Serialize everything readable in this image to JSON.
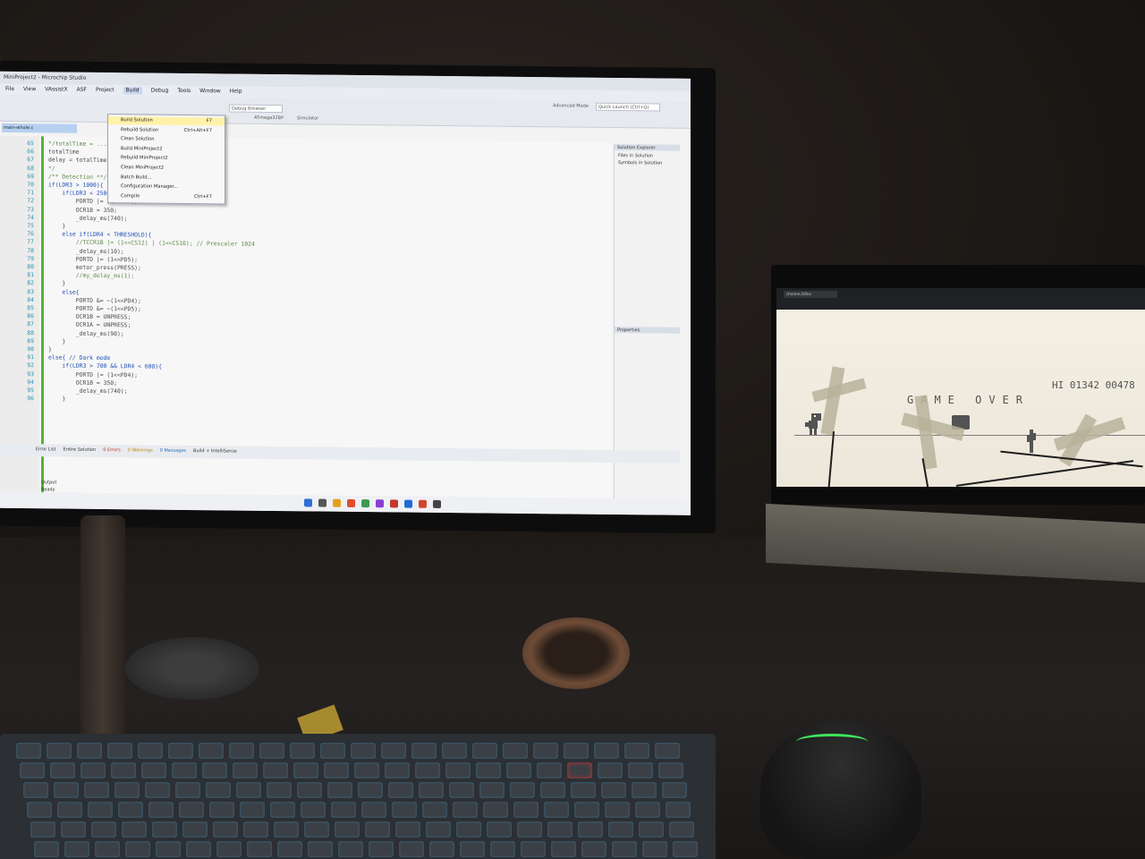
{
  "vs": {
    "title": "MiniProject2 - Microchip Studio",
    "menu": [
      "File",
      "View",
      "VAssistX",
      "ASF",
      "Project",
      "Build",
      "Debug",
      "Tools",
      "Window",
      "Help"
    ],
    "active_menu": "Build",
    "toolbar": {
      "debug_config": "Debug Browser",
      "device": "ATmega328P",
      "tool": "Simulator",
      "mode": "Advanced Mode",
      "quick_launch": "Quick Launch (Ctrl+Q)"
    },
    "tab_name": "main-whole.c",
    "build_menu": [
      {
        "label": "Build Solution",
        "shortcut": "F7"
      },
      {
        "label": "Rebuild Solution",
        "shortcut": "Ctrl+Alt+F7"
      },
      {
        "label": "Clean Solution",
        "shortcut": ""
      },
      {
        "label": "Build MiniProject2",
        "shortcut": ""
      },
      {
        "label": "Rebuild MiniProject2",
        "shortcut": ""
      },
      {
        "label": "Clean MiniProject2",
        "shortcut": ""
      },
      {
        "label": "Batch Build...",
        "shortcut": ""
      },
      {
        "label": "Configuration Manager...",
        "shortcut": ""
      },
      {
        "label": "Compile",
        "shortcut": "Ctrl+F7"
      }
    ],
    "code": [
      {
        "ln": "65",
        "text": "*/totalTime = ...extraCount;",
        "cls": "comment"
      },
      {
        "ln": "66",
        "text": "totalTime",
        "cls": ""
      },
      {
        "ln": "67",
        "text": "delay = totalTime * 1000;",
        "cls": ""
      },
      {
        "ln": "68",
        "text": "*/",
        "cls": "comment"
      },
      {
        "ln": "69",
        "text": "/** Detection **/",
        "cls": "comment"
      },
      {
        "ln": "70",
        "text": "if(LDR3 > 1000){ // LIGHT MODE",
        "cls": "kw"
      },
      {
        "ln": "71",
        "text": "    if(LDR3 < 2500 && LDR4 > THRESHOLD){",
        "cls": "kw"
      },
      {
        "ln": "72",
        "text": "        PORTD |= (1<<PD4);",
        "cls": ""
      },
      {
        "ln": "73",
        "text": "        OCR1B = 350;",
        "cls": ""
      },
      {
        "ln": "74",
        "text": "        _delay_ms(740);",
        "cls": ""
      },
      {
        "ln": "75",
        "text": "    }",
        "cls": ""
      },
      {
        "ln": "76",
        "text": "    else if(LDR4 < THRESHOLD){",
        "cls": "kw"
      },
      {
        "ln": "77",
        "text": "        //TCCR1B |= (1<<CS12) | (1<<CS10); // Prescaler 1024",
        "cls": "comment"
      },
      {
        "ln": "78",
        "text": "        _delay_ms(10);",
        "cls": ""
      },
      {
        "ln": "79",
        "text": "        PORTD |= (1<<PD5);",
        "cls": ""
      },
      {
        "ln": "80",
        "text": "        motor_press(PRESS);",
        "cls": ""
      },
      {
        "ln": "81",
        "text": "        //my_delay_ms(1);",
        "cls": "comment"
      },
      {
        "ln": "82",
        "text": "    }",
        "cls": ""
      },
      {
        "ln": "83",
        "text": "    else{",
        "cls": "kw"
      },
      {
        "ln": "84",
        "text": "        PORTD &= ~(1<<PD4);",
        "cls": ""
      },
      {
        "ln": "85",
        "text": "        PORTD &= ~(1<<PD5);",
        "cls": ""
      },
      {
        "ln": "86",
        "text": "        OCR1B = UNPRESS;",
        "cls": ""
      },
      {
        "ln": "87",
        "text": "        OCR1A = UNPRESS;",
        "cls": ""
      },
      {
        "ln": "88",
        "text": "        _delay_ms(90);",
        "cls": ""
      },
      {
        "ln": "89",
        "text": "    }",
        "cls": ""
      },
      {
        "ln": "90",
        "text": "}",
        "cls": ""
      },
      {
        "ln": "91",
        "text": "else{ // Dark mode",
        "cls": "kw"
      },
      {
        "ln": "92",
        "text": "    if(LDR3 > 700 && LDR4 < 600){",
        "cls": "kw"
      },
      {
        "ln": "93",
        "text": "        PORTD |= (1<<PD4);",
        "cls": ""
      },
      {
        "ln": "94",
        "text": "        OCR1B = 350;",
        "cls": ""
      },
      {
        "ln": "95",
        "text": "        _delay_ms(740);",
        "cls": ""
      },
      {
        "ln": "96",
        "text": "    }",
        "cls": ""
      }
    ],
    "side_panel": {
      "title": "Solution Explorer",
      "items": [
        "Files in Solution",
        "Symbols in Solution"
      ],
      "properties_title": "Properties"
    },
    "error_list": {
      "title": "Error List",
      "scope": "Entire Solution",
      "errors": "0 Errors",
      "warnings": "0 Warnings",
      "messages": "0 Messages",
      "filter": "Build + IntelliSense"
    },
    "output_label": "Output",
    "status": "Ready"
  },
  "game": {
    "browser_tab": "chrome://dino",
    "game_over": "GAME OVER",
    "hi_score": "HI 01342 00478"
  },
  "colors": {
    "editor_bg": "#f7f7f7",
    "code_comment": "#5c8a4a",
    "code_keyword": "#1f4fb5",
    "game_ink": "#535353",
    "mouse_led": "#3fe45c",
    "key_glow": "#3caadc"
  }
}
